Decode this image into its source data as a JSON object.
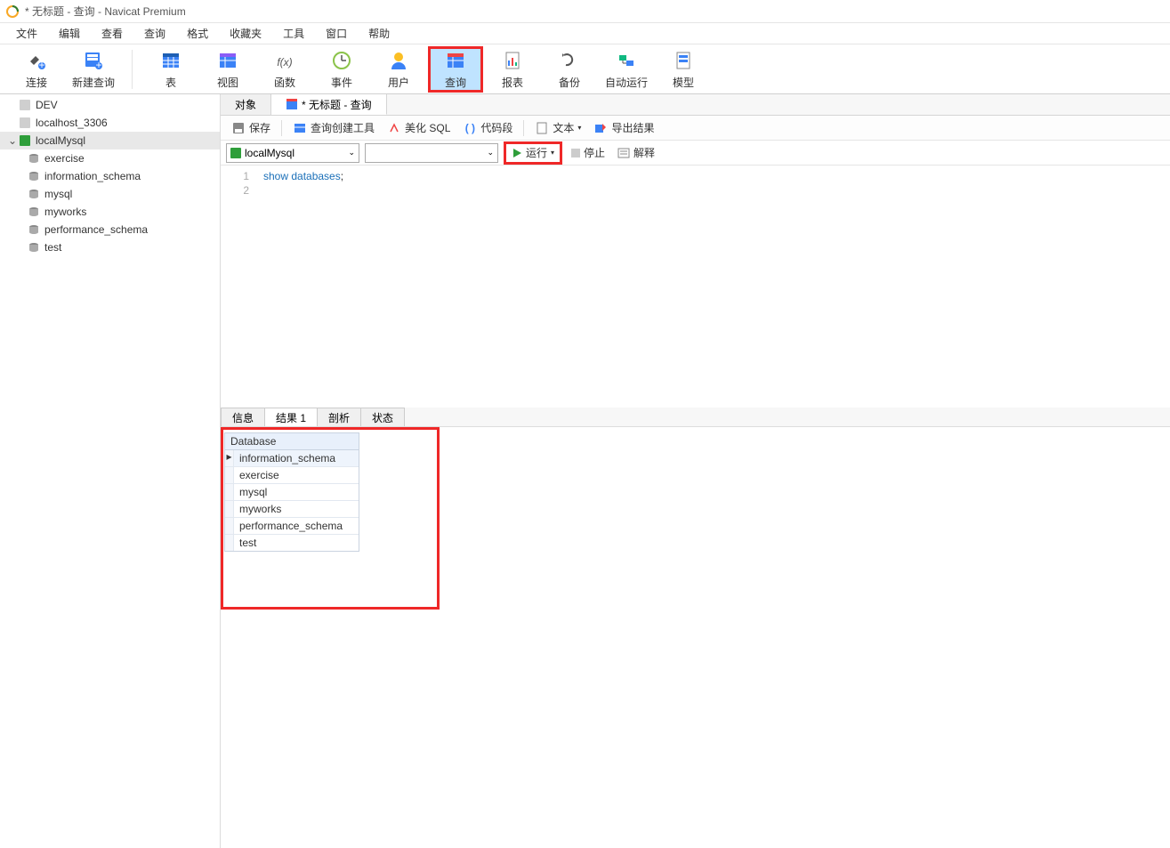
{
  "window": {
    "title": "* 无标题 - 查询 - Navicat Premium"
  },
  "menubar": {
    "items": [
      "文件",
      "编辑",
      "查看",
      "查询",
      "格式",
      "收藏夹",
      "工具",
      "窗口",
      "帮助"
    ]
  },
  "maintoolbar": {
    "items": [
      {
        "label": "连接",
        "icon": "plug"
      },
      {
        "label": "新建查询",
        "icon": "newquery"
      }
    ],
    "items2": [
      {
        "label": "表",
        "icon": "table"
      },
      {
        "label": "视图",
        "icon": "view"
      },
      {
        "label": "函数",
        "icon": "fx"
      },
      {
        "label": "事件",
        "icon": "clock"
      },
      {
        "label": "用户",
        "icon": "user"
      },
      {
        "label": "查询",
        "icon": "query",
        "highlight": true
      },
      {
        "label": "报表",
        "icon": "report"
      },
      {
        "label": "备份",
        "icon": "backup"
      },
      {
        "label": "自动运行",
        "icon": "auto"
      },
      {
        "label": "模型",
        "icon": "model"
      }
    ]
  },
  "sidebar": {
    "connections": [
      {
        "label": "DEV",
        "selected": false,
        "expanded": false
      },
      {
        "label": "localhost_3306",
        "selected": false,
        "expanded": false
      },
      {
        "label": "localMysql",
        "selected": true,
        "expanded": true,
        "children": [
          {
            "label": "exercise"
          },
          {
            "label": "information_schema"
          },
          {
            "label": "mysql"
          },
          {
            "label": "myworks"
          },
          {
            "label": "performance_schema"
          },
          {
            "label": "test"
          }
        ]
      }
    ]
  },
  "tabs": {
    "items": [
      {
        "label": "对象",
        "active": false
      },
      {
        "label": "* 无标题 - 查询",
        "active": true,
        "icon": "query"
      }
    ]
  },
  "subtoolbar": {
    "save": "保存",
    "builder": "查询创建工具",
    "beautify": "美化 SQL",
    "snippet": "代码段",
    "text": "文本",
    "export": "导出结果"
  },
  "querybar": {
    "connection": "localMysql",
    "database": "",
    "run": "运行",
    "stop": "停止",
    "explain": "解释"
  },
  "editor": {
    "lines": [
      "1",
      "2"
    ],
    "code_kw": "show databases",
    "code_tail": ";"
  },
  "result_tabs": {
    "items": [
      "信息",
      "结果 1",
      "剖析",
      "状态"
    ],
    "active": 1
  },
  "result": {
    "header": "Database",
    "rows": [
      {
        "v": "information_schema",
        "sel": true
      },
      {
        "v": "exercise"
      },
      {
        "v": "mysql"
      },
      {
        "v": "myworks"
      },
      {
        "v": "performance_schema"
      },
      {
        "v": "test"
      }
    ]
  }
}
